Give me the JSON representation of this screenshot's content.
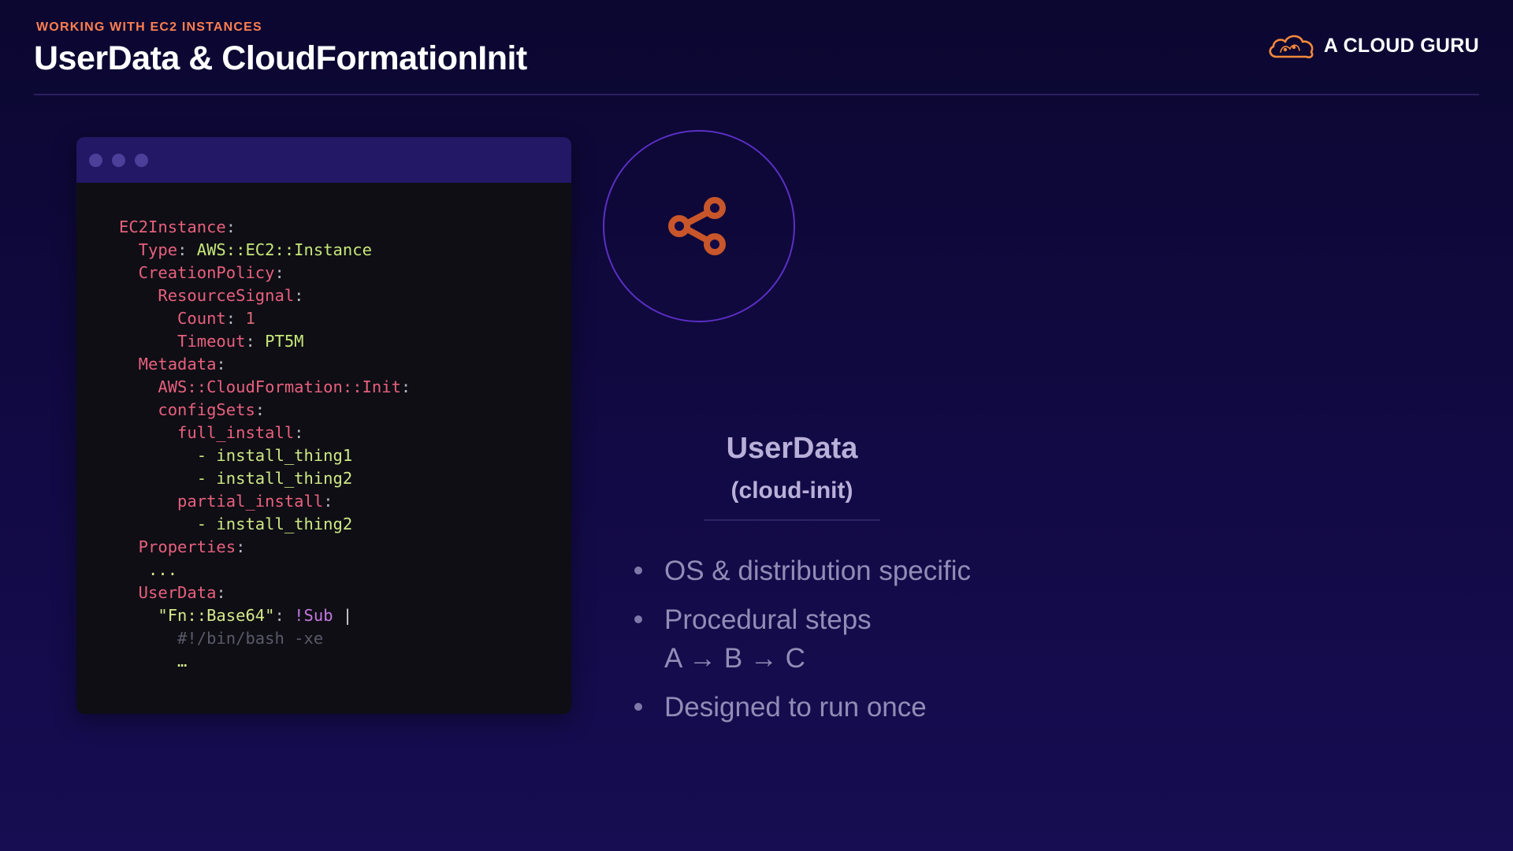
{
  "header": {
    "kicker": "WORKING WITH EC2 INSTANCES",
    "title": "UserData  & CloudFormationInit",
    "brand": "A CLOUD GURU"
  },
  "code": {
    "lines": [
      [
        [
          "k",
          "EC2Instance"
        ],
        [
          "p",
          ":"
        ]
      ],
      [
        [
          "k",
          "  Type"
        ],
        [
          "p",
          ": "
        ],
        [
          "v",
          "AWS::EC2::Instance"
        ]
      ],
      [
        [
          "k",
          "  CreationPolicy"
        ],
        [
          "p",
          ":"
        ]
      ],
      [
        [
          "k",
          "    ResourceSignal"
        ],
        [
          "p",
          ":"
        ]
      ],
      [
        [
          "k",
          "      Count"
        ],
        [
          "p",
          ": "
        ],
        [
          "d",
          "1"
        ]
      ],
      [
        [
          "k",
          "      Timeout"
        ],
        [
          "p",
          ": "
        ],
        [
          "v",
          "PT5M"
        ]
      ],
      [
        [
          "k",
          "  Metadata"
        ],
        [
          "p",
          ":"
        ]
      ],
      [
        [
          "k",
          "    AWS::CloudFormation::Init"
        ],
        [
          "p",
          ":"
        ]
      ],
      [
        [
          "k",
          "    configSets"
        ],
        [
          "p",
          ":"
        ]
      ],
      [
        [
          "k",
          "      full_install"
        ],
        [
          "p",
          ":"
        ]
      ],
      [
        [
          "t",
          "        - install_thing1"
        ]
      ],
      [
        [
          "t",
          "        - install_thing2"
        ]
      ],
      [
        [
          "k",
          "      partial_install"
        ],
        [
          "p",
          ":"
        ]
      ],
      [
        [
          "t",
          "        - install_thing2"
        ]
      ],
      [
        [
          "k",
          "  Properties"
        ],
        [
          "p",
          ":"
        ]
      ],
      [
        [
          "f",
          "   ..."
        ]
      ],
      [
        [
          "k",
          "  UserData"
        ],
        [
          "p",
          ":"
        ]
      ],
      [
        [
          "f",
          "    \"Fn::Base64\""
        ],
        [
          "p",
          ": "
        ],
        [
          "s",
          "!Sub "
        ],
        [
          "e",
          "|"
        ]
      ],
      [
        [
          "c",
          "      #!/bin/bash -xe"
        ]
      ],
      [
        [
          "f",
          "      …"
        ]
      ]
    ]
  },
  "main": {
    "heading": "UserData",
    "subheading": "(cloud-init)",
    "bullets": [
      {
        "text": "OS & distribution specific",
        "sub": ""
      },
      {
        "text": "Procedural steps",
        "sub": "A → B → C"
      },
      {
        "text": "Designed to run once",
        "sub": ""
      }
    ]
  },
  "colors": {
    "accent": "#ff7f50",
    "icon": "#c8562a",
    "circle": "#5a2fc4"
  },
  "icons": {
    "brand": "cloud-logo-icon",
    "main": "share-icon"
  }
}
